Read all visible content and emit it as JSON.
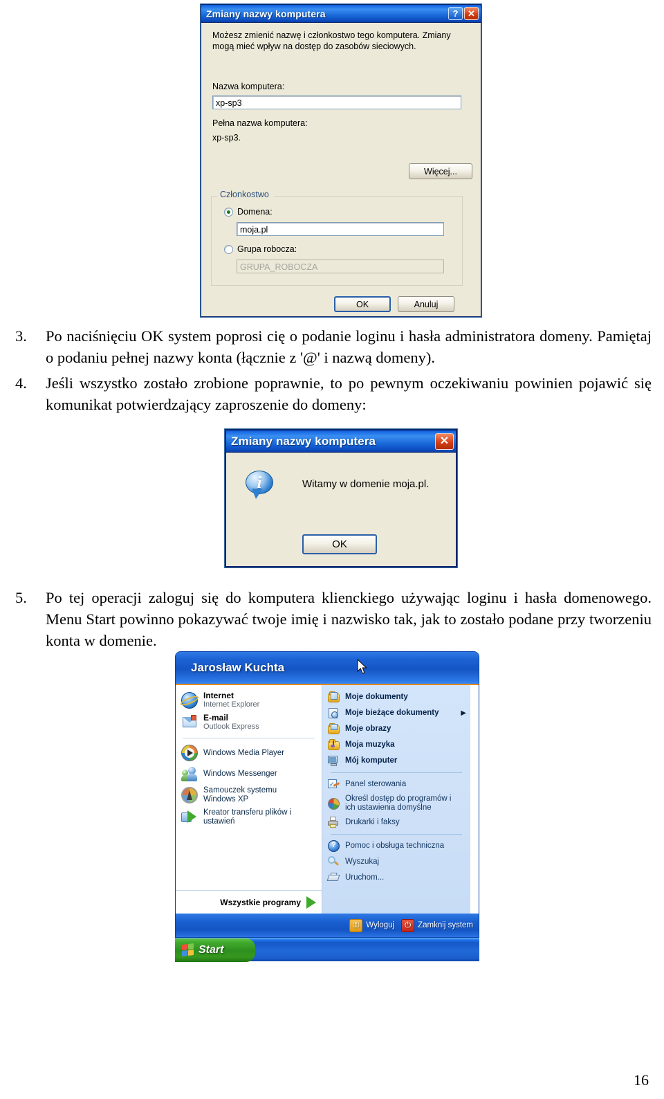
{
  "document": {
    "page_number": "16",
    "paragraphs": [
      {
        "number": "3.",
        "text": "Po naciśnięciu OK system poprosi cię o podanie loginu i hasła administratora domeny. Pamiętaj o podaniu pełnej nazwy konta (łącznie z '@' i nazwą domeny)."
      },
      {
        "number": "4.",
        "text": "Jeśli wszystko zostało zrobione poprawnie, to po pewnym oczekiwaniu powinien pojawić się komunikat potwierdzający zaproszenie do domeny:"
      },
      {
        "number": "5.",
        "text": "Po tej operacji zaloguj się do komputera klienckiego używając loginu i hasła domenowego. Menu Start powinno pokazywać twoje imię i nazwisko tak, jak to zostało podane przy tworzeniu konta w domenie."
      }
    ]
  },
  "dialog_computer_name": {
    "title": "Zmiany nazwy komputera",
    "help_button": "?",
    "close_button": "✕",
    "description": "Możesz zmienić nazwę i członkostwo tego komputera. Zmiany mogą mieć wpływ na dostęp do zasobów sieciowych.",
    "computer_name_label": "Nazwa komputera:",
    "computer_name_value": "xp-sp3",
    "full_name_label": "Pełna nazwa komputera:",
    "full_name_value": "xp-sp3.",
    "more_button": "Więcej...",
    "membership_legend": "Członkostwo",
    "domain_radio_label": "Domena:",
    "domain_value": "moja.pl",
    "domain_selected": true,
    "workgroup_radio_label": "Grupa robocza:",
    "workgroup_value": "GRUPA_ROBOCZA",
    "workgroup_selected": false,
    "ok_button": "OK",
    "cancel_button": "Anuluj"
  },
  "dialog_welcome": {
    "title": "Zmiany nazwy komputera",
    "close_button": "✕",
    "icon": "information-icon",
    "icon_glyph": "i",
    "message": "Witamy w domenie moja.pl.",
    "ok_button": "OK"
  },
  "start_menu": {
    "user_name": "Jarosław Kuchta",
    "left_pinned": [
      {
        "title": "Internet",
        "subtitle": "Internet Explorer",
        "icon": "internet-explorer-icon"
      },
      {
        "title": "E-mail",
        "subtitle": "Outlook Express",
        "icon": "outlook-express-icon"
      }
    ],
    "left_items": [
      {
        "label": "Windows Media Player",
        "icon": "windows-media-player-icon"
      },
      {
        "label": "Windows Messenger",
        "icon": "windows-messenger-icon"
      },
      {
        "label": "Samouczek systemu Windows XP",
        "icon": "tour-windows-xp-icon"
      },
      {
        "label": "Kreator transferu plików i ustawień",
        "icon": "files-settings-transfer-wizard-icon"
      }
    ],
    "all_programs_label": "Wszystkie programy",
    "all_programs_arrow": "▶",
    "right_group1": [
      {
        "label": "Moje dokumenty",
        "icon": "my-documents-icon",
        "submenu": false
      },
      {
        "label": "Moje bieżące dokumenty",
        "icon": "my-recent-documents-icon",
        "submenu": true,
        "arrow": "▶"
      },
      {
        "label": "Moje obrazy",
        "icon": "my-pictures-icon",
        "submenu": false
      },
      {
        "label": "Moja muzyka",
        "icon": "my-music-icon",
        "submenu": false
      },
      {
        "label": "Mój komputer",
        "icon": "my-computer-icon",
        "submenu": false
      }
    ],
    "right_group2": [
      {
        "label": "Panel sterowania",
        "icon": "control-panel-icon"
      },
      {
        "label": "Określ dostęp do programów i ich ustawienia domyślne",
        "icon": "set-program-access-icon"
      },
      {
        "label": "Drukarki i faksy",
        "icon": "printers-and-faxes-icon"
      }
    ],
    "right_group3": [
      {
        "label": "Pomoc i obsługa techniczna",
        "icon": "help-and-support-icon"
      },
      {
        "label": "Wyszukaj",
        "icon": "search-icon"
      },
      {
        "label": "Uruchom...",
        "icon": "run-icon"
      }
    ],
    "log_off_label": "Wyloguj",
    "log_off_icon": "key-icon",
    "shut_down_label": "Zamknij system",
    "shut_down_icon": "power-icon",
    "taskbar": {
      "start_label": "Start",
      "start_icon": "windows-flag-icon"
    },
    "cursor": "mouse-pointer"
  },
  "colors": {
    "title_bar_blue": "#1a6ada",
    "dialog_face": "#ece9d8",
    "accent_orange": "#e08a1e",
    "start_green": "#2e8f1f",
    "selected_radio_green": "#1b7a1b"
  }
}
